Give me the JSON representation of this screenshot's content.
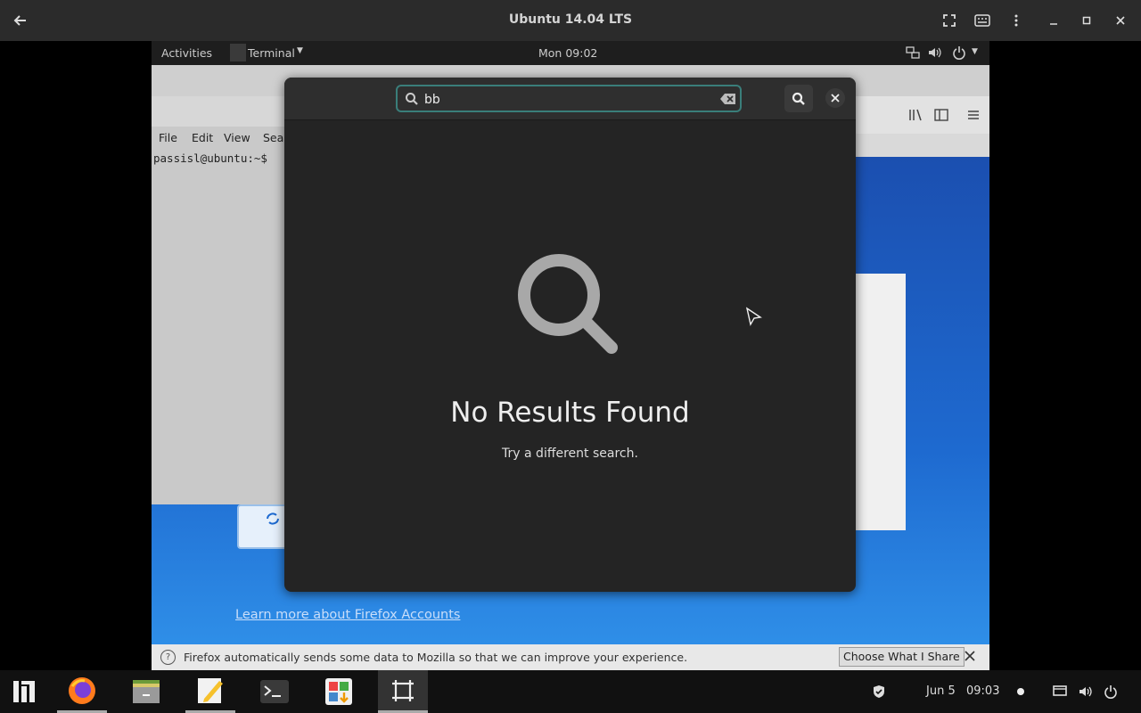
{
  "host": {
    "title": "Ubuntu 14.04 LTS"
  },
  "gnome_bar": {
    "activities": "Activities",
    "app_menu": "Terminal",
    "clock": "Mon 09:02"
  },
  "terminal": {
    "menu": [
      "File",
      "Edit",
      "View",
      "Sea"
    ],
    "prompt": "passisl@ubuntu:~$"
  },
  "firefox": {
    "learn_more_link": "Learn more about Firefox Accounts",
    "info_text": "Firefox automatically sends some data to Mozilla so that we can improve your experience.",
    "choose_button": "Choose What I Share"
  },
  "search": {
    "query": "bb",
    "no_results_title": "No Results Found",
    "no_results_hint": "Try a different search."
  },
  "taskbar": {
    "date": "Jun 5",
    "time": "09:03"
  },
  "colors": {
    "accent": "#3a7e7a",
    "overlay_bg": "#242424",
    "firefox_blue": "#1e6ad0"
  }
}
